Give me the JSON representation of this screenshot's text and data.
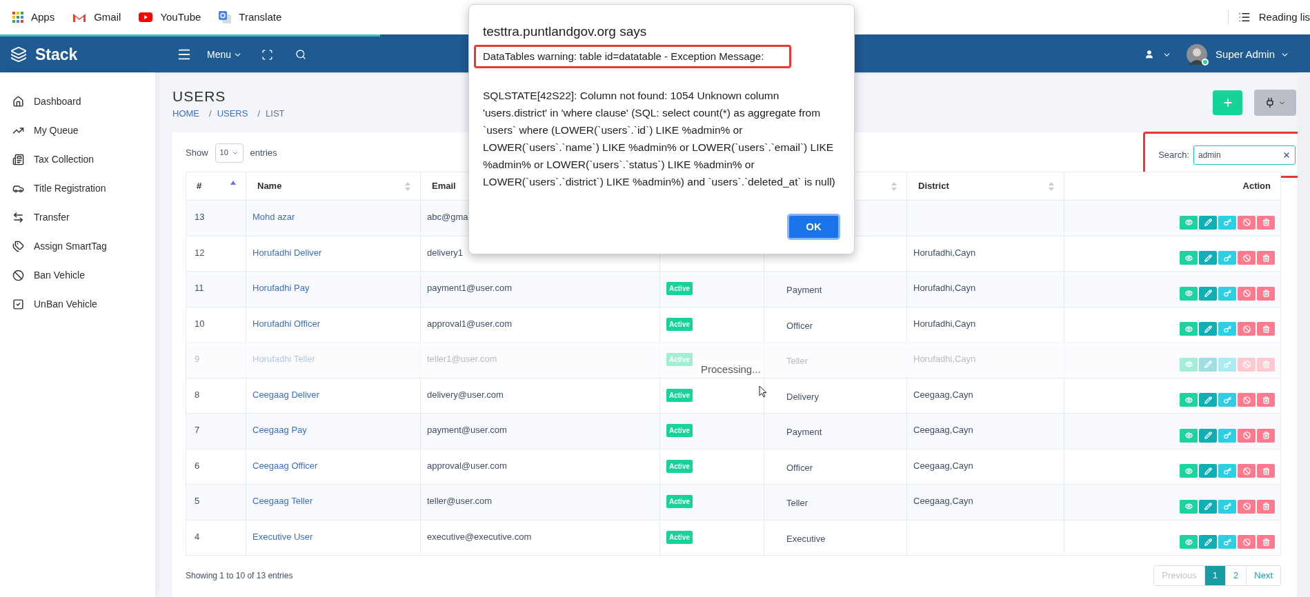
{
  "browser": {
    "bookmarks": [
      {
        "label": "Apps"
      },
      {
        "label": "Gmail"
      },
      {
        "label": "YouTube"
      },
      {
        "label": "Translate"
      }
    ],
    "reading_list": "Reading lis",
    "loading_bar": {
      "level": 0.29
    }
  },
  "navbar": {
    "brand": "Stack",
    "menu": "Menu",
    "user": "Super Admin",
    "online": true
  },
  "sidebar": {
    "items": [
      {
        "label": "Dashboard"
      },
      {
        "label": "My Queue"
      },
      {
        "label": "Tax Collection"
      },
      {
        "label": "Title Registration"
      },
      {
        "label": "Transfer"
      },
      {
        "label": "Assign SmartTag"
      },
      {
        "label": "Ban Vehicle"
      },
      {
        "label": "UnBan Vehicle"
      }
    ]
  },
  "page": {
    "title": "USERS",
    "breadcrumb": [
      {
        "label": "HOME",
        "link": true
      },
      {
        "separator": "/",
        "label": "USERS",
        "link": true
      },
      {
        "separator": "/",
        "label": "LIST",
        "link": false
      }
    ]
  },
  "table_controls": {
    "show_label": "Show",
    "page_size": "10",
    "entries_label": "entries",
    "search_label": "Search:",
    "search_value": "admin",
    "search_highlighted": true
  },
  "table": {
    "columns": [
      {
        "label": "#",
        "sortable": true,
        "sorted": true
      },
      {
        "label": "Name",
        "sortable": true,
        "sorted": false
      },
      {
        "label": "Email"
      },
      {
        "sortable": true,
        "sorted": false
      },
      {
        "label": "District",
        "sortable": true,
        "sorted": false
      },
      {
        "label": "Action"
      }
    ],
    "rows": [
      {
        "id": "13",
        "name": "Mohd azar",
        "email": "abc@gma",
        "dimmed": false
      },
      {
        "id": "12",
        "name": "Horufadhi Deliver",
        "email": "delivery1",
        "district": "Horufadhi,Cayn",
        "dimmed": false
      },
      {
        "id": "11",
        "name": "Horufadhi Pay",
        "email": "payment1@user.com",
        "status": "Active",
        "role": "Payment",
        "district": "Horufadhi,Cayn",
        "dimmed": false
      },
      {
        "id": "10",
        "name": "Horufadhi Officer",
        "email": "approval1@user.com",
        "status": "Active",
        "role": "Officer",
        "district": "Horufadhi,Cayn",
        "dimmed": false
      },
      {
        "id": "9",
        "name": "Horufadhi Teller",
        "email": "teller1@user.com",
        "status": "Active",
        "role": "Teller",
        "district": "Horufadhi,Cayn",
        "dimmed": true
      },
      {
        "id": "8",
        "name": "Ceegaag Deliver",
        "email": "delivery@user.com",
        "status": "Active",
        "role": "Delivery",
        "district": "Ceegaag,Cayn",
        "dimmed": false
      },
      {
        "id": "7",
        "name": "Ceegaag Pay",
        "email": "payment@user.com",
        "status": "Active",
        "role": "Payment",
        "district": "Ceegaag,Cayn",
        "dimmed": false
      },
      {
        "id": "6",
        "name": "Ceegaag Officer",
        "email": "approval@user.com",
        "status": "Active",
        "role": "Officer",
        "district": "Ceegaag,Cayn",
        "dimmed": false
      },
      {
        "id": "5",
        "name": "Ceegaag Teller",
        "email": "teller@user.com",
        "status": "Active",
        "role": "Teller",
        "district": "Ceegaag,Cayn",
        "dimmed": false
      },
      {
        "id": "4",
        "name": "Executive User",
        "email": "executive@executive.com",
        "status": "Active",
        "role": "Executive",
        "dimmed": false
      }
    ],
    "actions": [
      {
        "kind": "view",
        "color": "#1dd3a0"
      },
      {
        "kind": "edit",
        "color": "#11aeb6"
      },
      {
        "kind": "key",
        "color": "#2ccfe4"
      },
      {
        "kind": "ban",
        "color": "#ff7a8c"
      },
      {
        "kind": "delete",
        "color": "#ff7a8c"
      }
    ],
    "processing": "Processing..."
  },
  "footer": {
    "info": "Showing 1 to 10 of 13 entries",
    "pagination": [
      {
        "label": "Previous",
        "selected": false,
        "disabled": true
      },
      {
        "label": "1",
        "selected": true,
        "disabled": false
      },
      {
        "label": "2",
        "selected": false,
        "disabled": false
      },
      {
        "label": "Next",
        "selected": false,
        "disabled": false
      }
    ]
  },
  "dialog": {
    "title": "testtra.puntlandgov.org says",
    "headline": "DataTables warning: table id=datatable - Exception Message:",
    "headline_highlighted": true,
    "message": "SQLSTATE[42S22]: Column not found: 1054 Unknown column 'users.district' in 'where clause' (SQL: select count(*) as aggregate from `users` where (LOWER(`users`.`id`) LIKE %admin% or LOWER(`users`.`name`) LIKE %admin% or LOWER(`users`.`email`) LIKE %admin% or LOWER(`users`.`status`) LIKE %admin% or LOWER(`users`.`district`) LIKE %admin%) and `users`.`deleted_at` is null)",
    "button": "OK"
  }
}
